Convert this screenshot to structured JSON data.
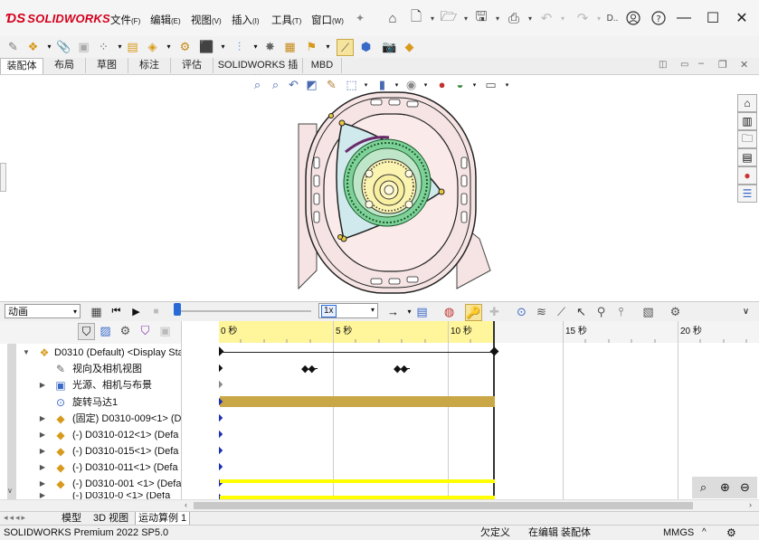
{
  "app": {
    "brand": "SOLIDWORKS",
    "menus": [
      {
        "label": "文件",
        "key": "F"
      },
      {
        "label": "编辑",
        "key": "E"
      },
      {
        "label": "视图",
        "key": "V"
      },
      {
        "label": "插入",
        "key": "I"
      },
      {
        "label": "工具",
        "key": "T"
      },
      {
        "label": "窗口",
        "key": "W"
      }
    ],
    "truncated": "D..",
    "colors": {
      "brand": "#d4001c",
      "timeline_yellow": "#fff59a",
      "bar_gold": "#c9a646",
      "bar_yellow": "#ffff00",
      "key_blue": "#1a2fb5"
    }
  },
  "tabs": [
    "装配体",
    "布局",
    "草图",
    "标注",
    "评估",
    "SOLIDWORKS 插件",
    "MBD"
  ],
  "motion": {
    "study_type": "动画",
    "speed": "1x"
  },
  "tree": {
    "root": "D0310 (Default) <Display Sta",
    "items": [
      {
        "label": "视向及相机视图",
        "expand": "",
        "icon": "camera-icon"
      },
      {
        "label": "光源、相机与布景",
        "expand": "▶",
        "icon": "lights-icon"
      },
      {
        "label": "旋转马达1",
        "expand": "",
        "icon": "motor-icon"
      },
      {
        "label": "(固定) D0310-009<1> (D",
        "expand": "▶",
        "icon": "part-icon"
      },
      {
        "label": "(-) D0310-012<1> (Defa",
        "expand": "▶",
        "icon": "part-icon"
      },
      {
        "label": "(-) D0310-015<1> (Defa",
        "expand": "▶",
        "icon": "part-icon"
      },
      {
        "label": "(-) D0310-011<1> (Defa",
        "expand": "▶",
        "icon": "part-icon"
      },
      {
        "label": "(-) D0310-001 <1> (Defa",
        "expand": "▶",
        "icon": "part-icon"
      },
      {
        "label": "(-) D0310-0 <1> (Defa",
        "expand": "▶",
        "icon": "part-icon"
      }
    ]
  },
  "timeline": {
    "ticks": [
      "0 秒",
      "5 秒",
      "10 秒",
      "15 秒",
      "20 秒"
    ]
  },
  "bottom_tabs": [
    "模型",
    "3D 视图",
    "运动算例 1"
  ],
  "status": {
    "version": "SOLIDWORKS Premium 2022 SP5.0",
    "state": "欠定义",
    "mode": "在编辑 装配体",
    "units": "MMGS"
  }
}
